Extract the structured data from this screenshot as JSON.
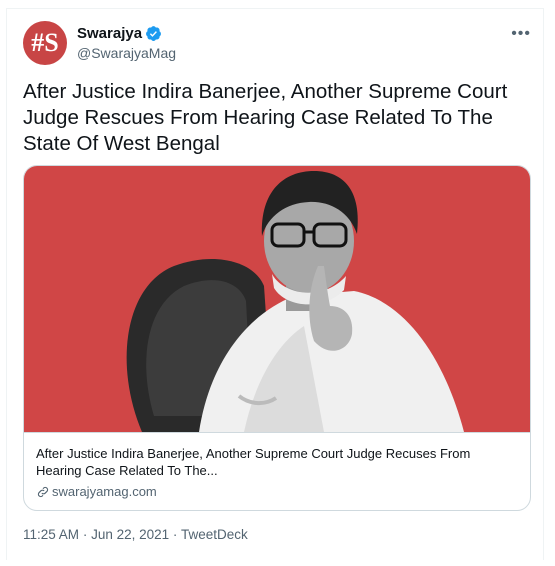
{
  "author": {
    "avatar_text": "#S",
    "display_name": "Swarajya",
    "handle": "@SwarajyaMag",
    "brand_color": "#c84545",
    "verified_icon": "verified-badge-icon"
  },
  "more_label": "•••",
  "tweet": {
    "text": "After Justice Indira Banerjee, Another Supreme Court Judge Rescues From Hearing Case Related To The State Of West Bengal"
  },
  "card": {
    "image_description_icon": "article-photo",
    "title": "After Justice Indira Banerjee, Another Supreme Court Judge Recuses From Hearing Case Related To The...",
    "domain": "swarajyamag.com",
    "domain_icon": "link-icon",
    "image_bg": "#d04646"
  },
  "meta": {
    "time": "11:25 AM",
    "separator": "·",
    "date": "Jun 22, 2021",
    "source": "TweetDeck"
  }
}
